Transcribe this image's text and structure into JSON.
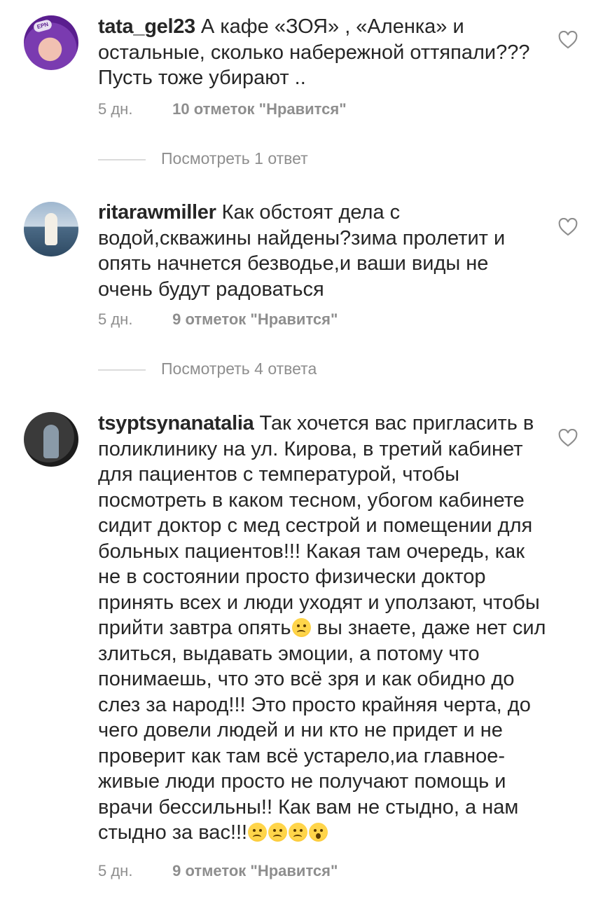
{
  "comments": [
    {
      "username": "tata_gel23",
      "avatar_badge": "EPN",
      "text": "А кафе «ЗОЯ» , «Аленка» и остальные, сколько набережной оттяпали??? Пусть тоже убирают ..",
      "time": "5 дн.",
      "likes": "10 отметок \"Нравится\"",
      "replies": "Посмотреть 1 ответ"
    },
    {
      "username": "ritarawmiller",
      "text": "Как обстоят дела с водой,скважины найдены?зима пролетит и опять начнется безводье,и ваши виды не очень будут радоваться",
      "time": "5 дн.",
      "likes": "9 отметок \"Нравится\"",
      "replies": "Посмотреть 4 ответа"
    },
    {
      "username": "tsyptsynanatalia",
      "text_part1": "Так хочется вас пригласить в поликлинику на ул. Кирова, в третий кабинет для пациентов с температурой, чтобы посмотреть в каком тесном, убогом кабинете сидит доктор с мед сестрой и помещении для больных пациентов!!! Какая там очередь, как не в состоянии просто физически доктор принять всех и люди уходят и уползают, чтобы прийти завтра опять",
      "text_part2": " вы знаете, даже нет сил злиться, выдавать эмоции, а потому что понимаешь, что это всё зря и как обидно до слез за народ!!! Это просто крайняя черта, до чего довели людей и ни кто не придет и не проверит как там всё устарело,иа главное- живые люди просто не получают помощь и врачи бессильны!! Как вам не стыдно, а нам стыдно за вас!!!",
      "time": "5 дн.",
      "likes": "9 отметок \"Нравится\""
    }
  ],
  "icons": {
    "like": "heart-outline-icon",
    "emoji_cry": "crying-face-emoji",
    "emoji_wow": "astonished-face-emoji"
  }
}
